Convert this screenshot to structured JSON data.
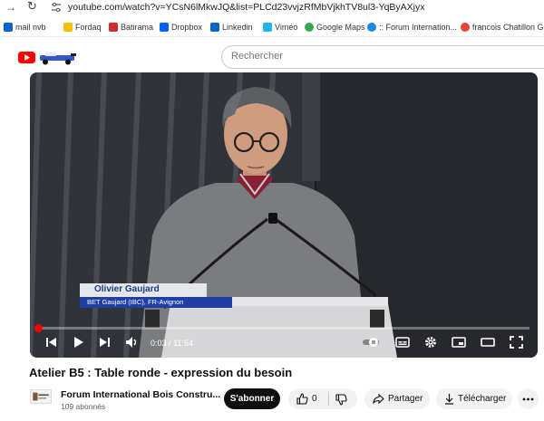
{
  "browser": {
    "url": "youtube.com/watch?v=YCsN6lMkwJQ&list=PLCd23vvjzRfMbVjkhTV8ul3-YqByAXjyx",
    "bookmarks": [
      {
        "label": "mail nvb",
        "icon": "outlook-icon",
        "color": "#0a64d6"
      },
      {
        "label": "Fordaq",
        "icon": "lightbulb-icon",
        "color": "#f2c200"
      },
      {
        "label": "Batirama",
        "icon": "batirama-icon",
        "color": "#d22a2a"
      },
      {
        "label": "Dropbox",
        "icon": "dropbox-icon",
        "color": "#0061fe"
      },
      {
        "label": "Linkedin",
        "icon": "linkedin-icon",
        "color": "#0a66c2"
      },
      {
        "label": "Viméo",
        "icon": "vimeo-icon",
        "color": "#19b7ea"
      },
      {
        "label": "Google Maps",
        "icon": "map-pin-icon",
        "color": "#34a853"
      },
      {
        "label": ":: Forum Internation...",
        "icon": "globe-icon",
        "color": "#1e88e5"
      },
      {
        "label": "francois Chatillon G...",
        "icon": "google-icon",
        "color": "#ea4335"
      }
    ]
  },
  "header": {
    "search_placeholder": "Rechercher"
  },
  "player": {
    "lower_third_name": "Olivier Gaujard",
    "lower_third_role": "BET Gaujard (IBC), FR-Avignon",
    "time": "0:03 / 11:54",
    "progress": 0.004
  },
  "video": {
    "title": "Atelier B5 : Table ronde - expression du besoin",
    "channel": "Forum International Bois Constru...",
    "subscribers": "109 abonnés",
    "subscribe_label": "S'abonner",
    "likes": "0",
    "share_label": "Partager",
    "download_label": "Télécharger"
  },
  "colors": {
    "youtube_red": "#ff0000",
    "lower_third_blue": "#1f3fa5"
  }
}
